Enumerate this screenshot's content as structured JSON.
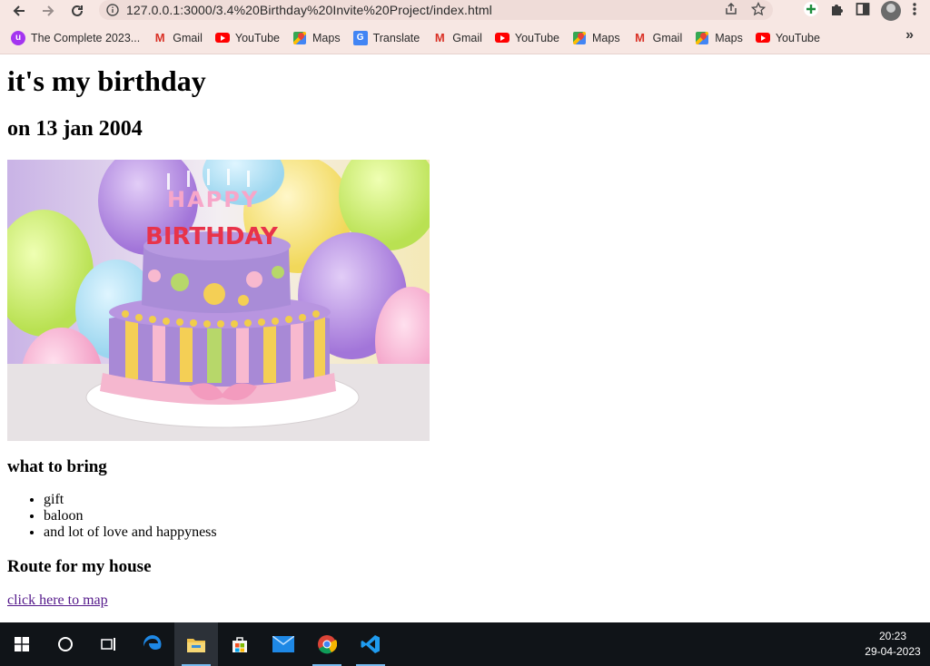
{
  "browser": {
    "url": "127.0.0.1:3000/3.4%20Birthday%20Invite%20Project/index.html",
    "bookmarks": [
      {
        "label": "The Complete 2023...",
        "icon": "udemy-icon"
      },
      {
        "label": "Gmail",
        "icon": "gmail-icon"
      },
      {
        "label": "YouTube",
        "icon": "youtube-icon"
      },
      {
        "label": "Maps",
        "icon": "maps-icon"
      },
      {
        "label": "Translate",
        "icon": "translate-icon"
      },
      {
        "label": "Gmail",
        "icon": "gmail-icon"
      },
      {
        "label": "YouTube",
        "icon": "youtube-icon"
      },
      {
        "label": "Maps",
        "icon": "maps-icon"
      },
      {
        "label": "Gmail",
        "icon": "gmail-icon"
      },
      {
        "label": "Maps",
        "icon": "maps-icon"
      },
      {
        "label": "YouTube",
        "icon": "youtube-icon"
      }
    ]
  },
  "page": {
    "title": "it's my birthday",
    "date": "on 13 jan 2004",
    "cake_lettering": [
      "HAPPY",
      "BIRTHDAY"
    ],
    "bring_heading": "what to bring",
    "bring_items": [
      "gift",
      "baloon",
      "and lot of love and happyness"
    ],
    "route_heading": "Route for my house",
    "map_link": "click here to map"
  },
  "taskbar": {
    "time": "20:23",
    "date": "29-04-2023",
    "apps": [
      "start-icon",
      "search-icon",
      "task-view-icon",
      "edge-icon",
      "file-explorer-icon",
      "store-icon",
      "mail-icon",
      "chrome-icon",
      "vscode-icon"
    ]
  }
}
